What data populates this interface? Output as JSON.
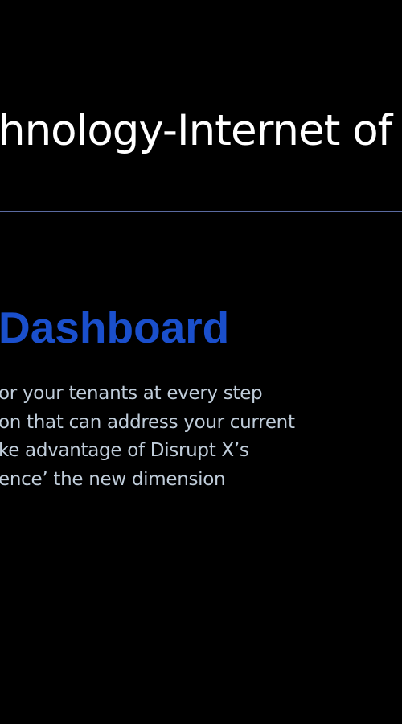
{
  "slide": {
    "title": "hnology-Internet of",
    "heading": "Dashboard",
    "body_lines": [
      "or your tenants at every step",
      "on that can address your current",
      "ke advantage of Disrupt X’s",
      "ence’ the new dimension"
    ]
  },
  "colors": {
    "background": "#000000",
    "title": "#ffffff",
    "heading": "#1a4fcc",
    "body": "#c0cdda",
    "divider": "#5a6aa0"
  }
}
